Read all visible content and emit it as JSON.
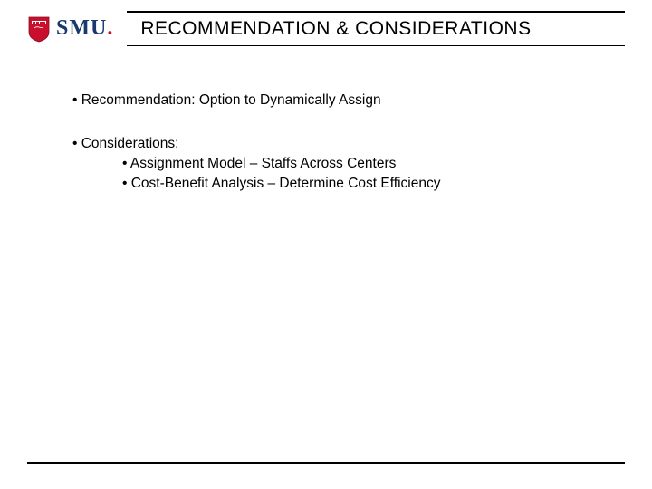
{
  "logo": {
    "text_main": "SMU",
    "text_dot": "."
  },
  "title": "RECOMMENDATION & CONSIDERATIONS",
  "content": {
    "recommendation_label": "Recommendation:",
    "recommendation_text": "Option to Dynamically Assign",
    "considerations_label": "Considerations:",
    "sub_items": [
      "Assignment Model – Staffs Across Centers",
      "Cost-Benefit Analysis – Determine Cost Efficiency"
    ]
  }
}
